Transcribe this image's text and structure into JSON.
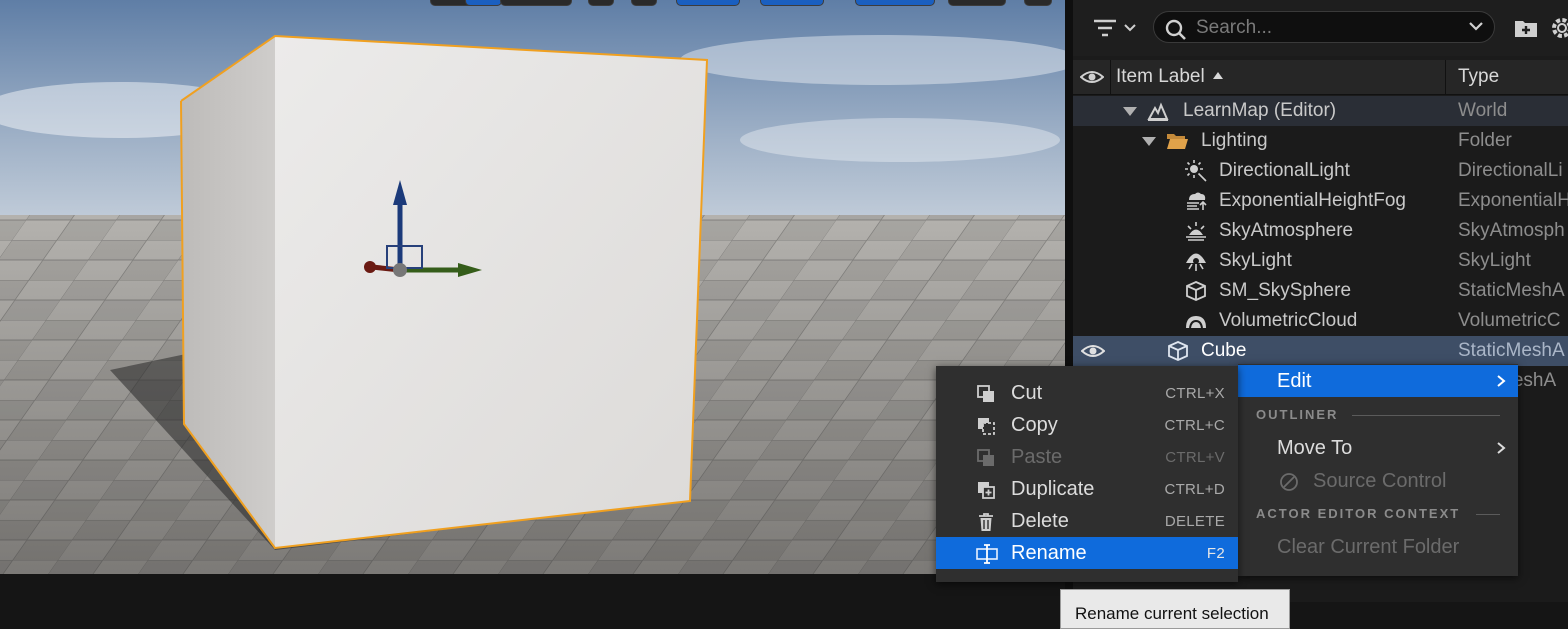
{
  "viewport": {
    "name": "Level Viewport"
  },
  "outliner": {
    "search": {
      "placeholder": "Search..."
    },
    "columns": {
      "label": "Item Label",
      "type": "Type"
    },
    "rows": [
      {
        "label": "LearnMap (Editor)",
        "type": "World",
        "icon": "world-icon"
      },
      {
        "label": "Lighting",
        "type": "Folder",
        "icon": "folder-open-icon"
      },
      {
        "label": "DirectionalLight",
        "type": "DirectionalLi",
        "icon": "directional-light-icon"
      },
      {
        "label": "ExponentialHeightFog",
        "type": "ExponentialH",
        "icon": "height-fog-icon"
      },
      {
        "label": "SkyAtmosphere",
        "type": "SkyAtmosph",
        "icon": "sky-atmosphere-icon"
      },
      {
        "label": "SkyLight",
        "type": "SkyLight",
        "icon": "sky-light-icon"
      },
      {
        "label": "SM_SkySphere",
        "type": "StaticMeshA",
        "icon": "static-mesh-icon"
      },
      {
        "label": "VolumetricCloud",
        "type": "VolumetricC",
        "icon": "volumetric-cloud-icon"
      },
      {
        "label": "Cube",
        "type": "StaticMeshA",
        "icon": "static-mesh-icon"
      },
      {
        "label": "",
        "type": "MeshA",
        "icon": ""
      }
    ]
  },
  "context_menu": {
    "items": [
      {
        "label": "Cut",
        "shortcut": "CTRL+X",
        "icon": "cut-icon",
        "enabled": true
      },
      {
        "label": "Copy",
        "shortcut": "CTRL+C",
        "icon": "copy-icon",
        "enabled": true
      },
      {
        "label": "Paste",
        "shortcut": "CTRL+V",
        "icon": "paste-icon",
        "enabled": false
      },
      {
        "label": "Duplicate",
        "shortcut": "CTRL+D",
        "icon": "duplicate-icon",
        "enabled": true
      },
      {
        "label": "Delete",
        "shortcut": "DELETE",
        "icon": "delete-icon",
        "enabled": true
      },
      {
        "label": "Rename",
        "shortcut": "F2",
        "icon": "rename-icon",
        "enabled": true,
        "highlighted": true
      }
    ]
  },
  "side_menu": {
    "edit": "Edit",
    "section_outliner": "OUTLINER",
    "move_to": "Move To",
    "source_control": "Source Control",
    "section_actor": "ACTOR EDITOR CONTEXT",
    "clear_folder": "Clear Current Folder"
  },
  "tooltip": "Rename current selection",
  "colors": {
    "accent": "#0f6bdc",
    "selection_outline": "#f0a020",
    "menu_bg": "#2f2f2f"
  }
}
